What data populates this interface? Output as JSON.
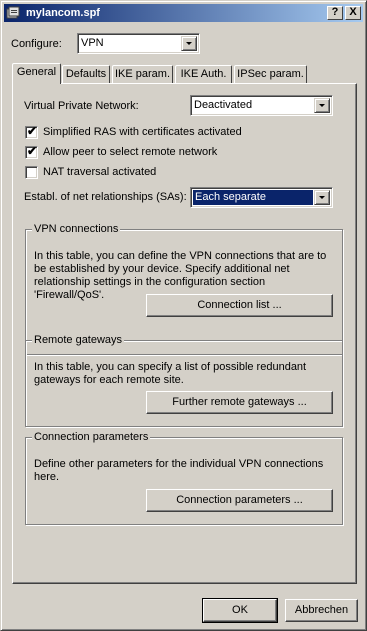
{
  "window": {
    "title": "mylancom.spf",
    "help_button": "?",
    "close_button": "X"
  },
  "configure": {
    "label": "Configure:",
    "value": "VPN"
  },
  "tabs": [
    {
      "label": "General"
    },
    {
      "label": "Defaults"
    },
    {
      "label": "IKE param."
    },
    {
      "label": "IKE Auth."
    },
    {
      "label": "IPSec param."
    }
  ],
  "general": {
    "vpn_label": "Virtual Private Network:",
    "vpn_value": "Deactivated",
    "checkboxes": [
      {
        "label": "Simplified RAS with certificates activated",
        "checked": true
      },
      {
        "label": "Allow peer to select remote network",
        "checked": true
      },
      {
        "label": "NAT traversal activated",
        "checked": false
      }
    ],
    "sa_label": "Establ. of net relationships (SAs):",
    "sa_value": "Each separate"
  },
  "groups": {
    "vpn_connections": {
      "title": "VPN connections",
      "text": "In this table, you can define the VPN connections that are to be established by your device. Specify additional net relationship settings in the configuration section 'Firewall/QoS'.",
      "button": "Connection list ..."
    },
    "remote_gateways": {
      "title": "Remote gateways",
      "text": "In this table, you can specify a list of possible redundant gateways for each remote site.",
      "button": "Further remote gateways ..."
    },
    "connection_parameters": {
      "title": "Connection parameters",
      "text": "Define other parameters for the individual VPN connections here.",
      "button": "Connection parameters ..."
    }
  },
  "footer": {
    "ok": "OK",
    "cancel": "Abbrechen"
  },
  "check_glyph": "✔"
}
